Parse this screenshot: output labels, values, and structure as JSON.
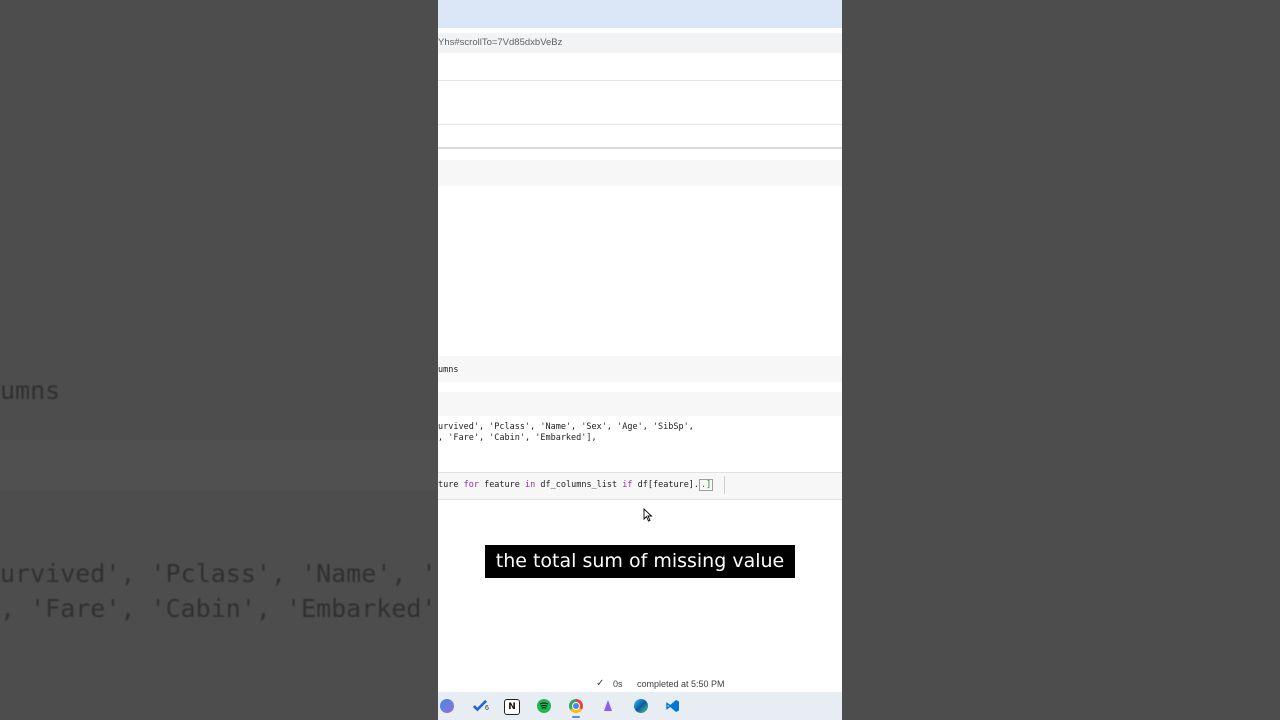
{
  "background": {
    "code_line_1": "umns",
    "code_line_2": "urvived', 'Pclass', 'Name', 'Sex'",
    "code_line_3": ", 'Fare', 'Cabin', 'Embarked'],"
  },
  "browser": {
    "url": "Yhs#scrollTo=7Vd85dxbVeBz"
  },
  "notebook": {
    "output_label": "umns",
    "output_line_1": "urvived', 'Pclass', 'Name', 'Sex', 'Age', 'SibSp',",
    "output_line_2": ", 'Fare', 'Cabin', 'Embarked'],",
    "input_prefix": "ture ",
    "input_kw_for": "for",
    "input_mid": " feature ",
    "input_kw_in": "in",
    "input_mid2": " df_columns_list ",
    "input_kw_if": "if",
    "input_suffix": " df[feature].",
    "input_caret": ".]"
  },
  "caption": {
    "text": "the total sum of missing value"
  },
  "status": {
    "check_icon": "✓",
    "duration": "0s",
    "completed": "completed at 5:50 PM"
  },
  "taskbar": {
    "icons": [
      "copilot-icon",
      "todo-icon",
      "notion-icon",
      "spotify-icon",
      "chrome-icon",
      "app-icon",
      "edge-icon",
      "vscode-icon"
    ],
    "todo_badge": "6"
  },
  "colors": {
    "keyword": "#9c27b0",
    "accent": "#5b8def"
  }
}
